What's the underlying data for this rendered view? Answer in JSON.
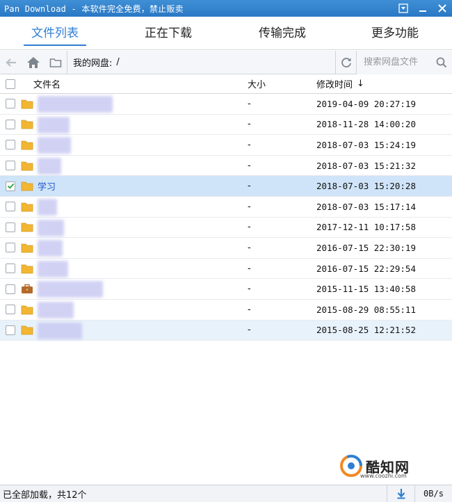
{
  "window": {
    "title": "Pan Download - 本软件完全免费，禁止贩卖"
  },
  "tabs": [
    {
      "label": "文件列表",
      "active": true
    },
    {
      "label": "正在下载",
      "active": false
    },
    {
      "label": "传输完成",
      "active": false
    },
    {
      "label": "更多功能",
      "active": false
    }
  ],
  "toolbar": {
    "path_label": "我的网盘:",
    "path_value": "/",
    "search_placeholder": "搜索网盘文件"
  },
  "table": {
    "columns": {
      "name": "文件名",
      "size": "大小",
      "modified": "修改时间",
      "sort_arrow": "↓"
    },
    "rows": [
      {
        "name": "",
        "size": "-",
        "modified": "2019-04-09 20:27:19",
        "checked": false,
        "icon": "folder-icon"
      },
      {
        "name": "",
        "size": "-",
        "modified": "2018-11-28 14:00:20",
        "checked": false,
        "icon": "folder-icon"
      },
      {
        "name": "",
        "size": "-",
        "modified": "2018-07-03 15:24:19",
        "checked": false,
        "icon": "folder-icon"
      },
      {
        "name": "",
        "size": "-",
        "modified": "2018-07-03 15:21:32",
        "checked": false,
        "icon": "folder-icon"
      },
      {
        "name": "学习",
        "size": "-",
        "modified": "2018-07-03 15:20:28",
        "checked": true,
        "icon": "folder-icon"
      },
      {
        "name": "",
        "size": "-",
        "modified": "2018-07-03 15:17:14",
        "checked": false,
        "icon": "folder-icon"
      },
      {
        "name": "",
        "size": "-",
        "modified": "2017-12-11 10:17:58",
        "checked": false,
        "icon": "folder-icon"
      },
      {
        "name": "",
        "size": "-",
        "modified": "2016-07-15 22:30:19",
        "checked": false,
        "icon": "folder-icon"
      },
      {
        "name": "",
        "size": "-",
        "modified": "2016-07-15 22:29:54",
        "checked": false,
        "icon": "folder-icon"
      },
      {
        "name": "",
        "size": "-",
        "modified": "2015-11-15 13:40:58",
        "checked": false,
        "icon": "briefcase-icon"
      },
      {
        "name": "",
        "size": "-",
        "modified": "2015-08-29 08:55:11",
        "checked": false,
        "icon": "folder-icon"
      },
      {
        "name": "",
        "size": "-",
        "modified": "2015-08-25 12:21:52",
        "checked": false,
        "icon": "folder-icon"
      }
    ]
  },
  "watermark": {
    "name": "酷知网",
    "url": "www.coozhi.com"
  },
  "status": {
    "text": "已全部加载，共12个",
    "speed": "0B/s"
  },
  "colors": {
    "titlebar": "#2f81cc",
    "accent": "#2e7fd2",
    "selected_row": "#cfe4f8",
    "folder": "#f2b632"
  }
}
